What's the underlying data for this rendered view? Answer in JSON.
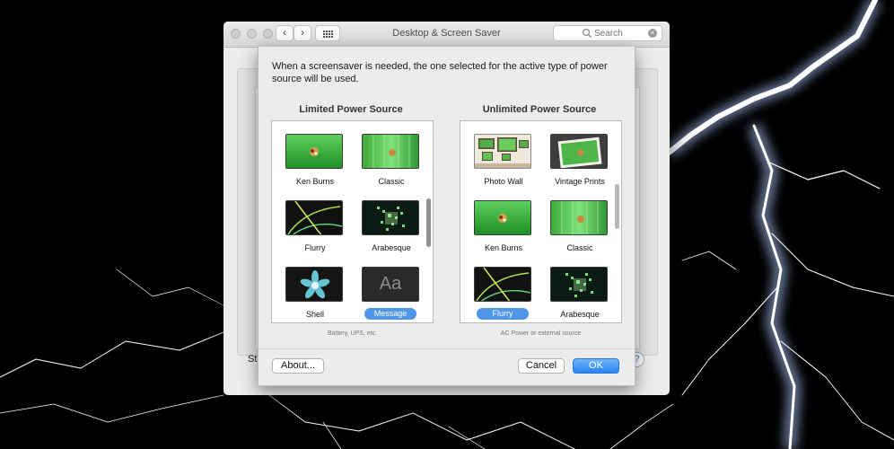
{
  "window": {
    "title": "Desktop & Screen Saver",
    "nav_back": "‹",
    "nav_forward": "›",
    "search_placeholder": "Search",
    "peek_label": "St",
    "peek_help": "?"
  },
  "sheet": {
    "message": "When a screensaver is needed, the one selected for the active type of power source will be used.",
    "limited": {
      "title": "Limited Power Source",
      "caption": "Battery, UPS, etc.",
      "items": [
        {
          "label": "Ken Burns",
          "thumb": "ken-burns",
          "selected": false
        },
        {
          "label": "Classic",
          "thumb": "classic",
          "selected": false
        },
        {
          "label": "Flurry",
          "thumb": "flurry",
          "selected": false
        },
        {
          "label": "Arabesque",
          "thumb": "arabesque",
          "selected": false
        },
        {
          "label": "Shell",
          "thumb": "shell",
          "selected": false
        },
        {
          "label": "Message",
          "thumb": "message",
          "selected": true
        }
      ]
    },
    "unlimited": {
      "title": "Unlimited Power Source",
      "caption": "AC Power or external source",
      "items": [
        {
          "label": "Photo Wall",
          "thumb": "photo-wall",
          "selected": false
        },
        {
          "label": "Vintage Prints",
          "thumb": "vintage-prints",
          "selected": false
        },
        {
          "label": "Ken Burns",
          "thumb": "ken-burns",
          "selected": false
        },
        {
          "label": "Classic",
          "thumb": "classic",
          "selected": false
        },
        {
          "label": "Flurry",
          "thumb": "flurry",
          "selected": true
        },
        {
          "label": "Arabesque",
          "thumb": "arabesque",
          "selected": false
        }
      ]
    },
    "message_thumb_text": "Aa",
    "buttons": {
      "about": "About...",
      "cancel": "Cancel",
      "ok": "OK"
    }
  },
  "colors": {
    "selection": "#4f96e8",
    "primary_button": "#2b84f2"
  }
}
